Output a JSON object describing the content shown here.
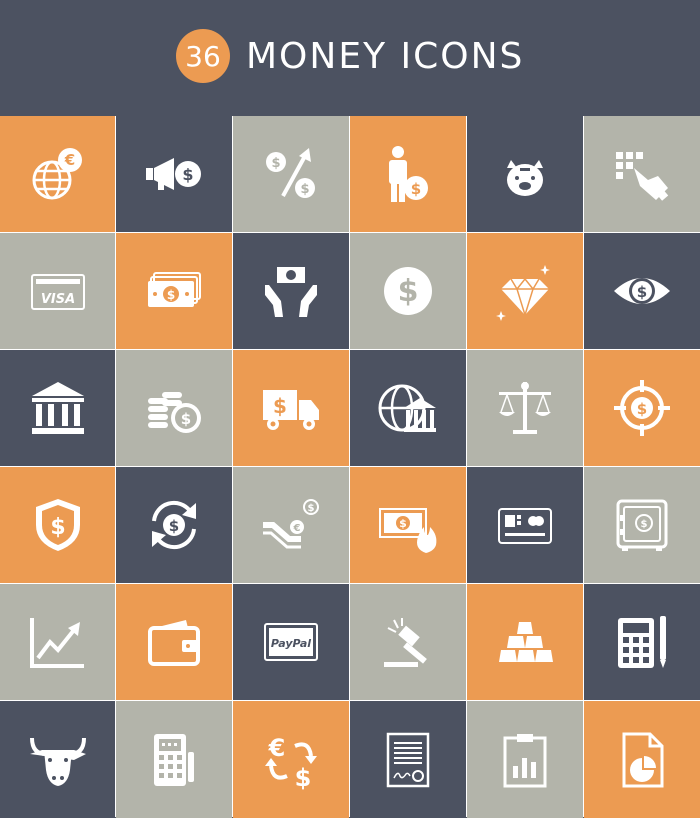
{
  "header": {
    "count": "36",
    "title": "MONEY ICONS"
  },
  "colors": {
    "orange": "#ec9b52",
    "dark": "#4c5261",
    "gray": "#b3b4aa",
    "icon": "#ffffff"
  },
  "icons": [
    {
      "name": "globe-euro-icon",
      "color": "orange"
    },
    {
      "name": "megaphone-dollar-icon",
      "color": "dark"
    },
    {
      "name": "dollar-growth-arrow-icon",
      "color": "gray"
    },
    {
      "name": "businessman-coin-icon",
      "color": "orange"
    },
    {
      "name": "piggy-bank-icon",
      "color": "dark"
    },
    {
      "name": "hand-keypad-icon",
      "color": "gray"
    },
    {
      "name": "visa-card-icon",
      "color": "gray",
      "text": "VISA"
    },
    {
      "name": "cash-stack-icon",
      "color": "orange"
    },
    {
      "name": "hands-holding-money-icon",
      "color": "dark"
    },
    {
      "name": "dollar-coin-icon",
      "color": "gray"
    },
    {
      "name": "diamond-icon",
      "color": "orange"
    },
    {
      "name": "eye-dollar-icon",
      "color": "dark"
    },
    {
      "name": "bank-building-icon",
      "color": "dark"
    },
    {
      "name": "coin-stacks-icon",
      "color": "gray"
    },
    {
      "name": "money-truck-icon",
      "color": "orange"
    },
    {
      "name": "global-bank-icon",
      "color": "dark"
    },
    {
      "name": "balance-scale-icon",
      "color": "gray"
    },
    {
      "name": "dollar-target-icon",
      "color": "orange"
    },
    {
      "name": "dollar-shield-icon",
      "color": "orange"
    },
    {
      "name": "dollar-exchange-icon",
      "color": "dark"
    },
    {
      "name": "escalator-euro-icon",
      "color": "gray"
    },
    {
      "name": "burning-money-icon",
      "color": "orange"
    },
    {
      "name": "credit-card-chip-icon",
      "color": "dark"
    },
    {
      "name": "safe-icon",
      "color": "gray"
    },
    {
      "name": "line-chart-icon",
      "color": "gray"
    },
    {
      "name": "wallet-icon",
      "color": "orange"
    },
    {
      "name": "paypal-card-icon",
      "color": "dark",
      "text": "PayPal"
    },
    {
      "name": "auction-gavel-icon",
      "color": "gray"
    },
    {
      "name": "gold-bars-icon",
      "color": "orange"
    },
    {
      "name": "calculator-pen-icon",
      "color": "dark"
    },
    {
      "name": "bull-icon",
      "color": "dark"
    },
    {
      "name": "pos-terminal-icon",
      "color": "gray"
    },
    {
      "name": "currency-exchange-icon",
      "color": "orange"
    },
    {
      "name": "signed-contract-icon",
      "color": "dark"
    },
    {
      "name": "clipboard-chart-icon",
      "color": "gray"
    },
    {
      "name": "pie-chart-document-icon",
      "color": "orange"
    }
  ]
}
